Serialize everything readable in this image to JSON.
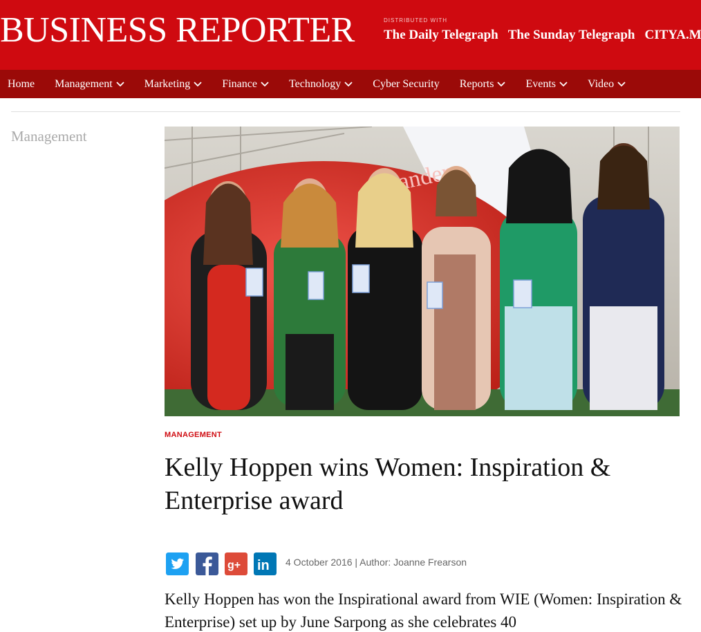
{
  "header": {
    "title": "BUSINESS REPORTER",
    "distributed_label": "DISTRIBUTED WITH",
    "partners": [
      "The Daily Telegraph",
      "The Sunday Telegraph",
      "CITYA.M."
    ]
  },
  "nav": {
    "items": [
      {
        "label": "Home"
      },
      {
        "label": "Management"
      },
      {
        "label": "Marketing"
      },
      {
        "label": "Finance"
      },
      {
        "label": "Technology"
      },
      {
        "label": "Cyber Security"
      },
      {
        "label": "Reports"
      },
      {
        "label": "Events"
      },
      {
        "label": "Video"
      }
    ]
  },
  "sidebar": {
    "section": "Management"
  },
  "article": {
    "category": "MANAGEMENT",
    "headline": "Kelly Hoppen wins Women: Inspiration & Enterprise award",
    "byline": "4 October 2016 | Author: Joanne Frearson",
    "lede": "Kelly Hoppen has won the Inspirational award from WIE (Women: Inspiration & Enterprise) set up by June Sarpong as she celebrates 40",
    "photo_banner_text": "antander"
  },
  "share": {
    "icons": [
      "twitter-icon",
      "facebook-icon",
      "google-plus-icon",
      "linkedin-icon"
    ],
    "colors": {
      "twitter": "#1da1f2",
      "facebook": "#3b5998",
      "google_plus": "#dd4b39",
      "linkedin": "#0077b5"
    }
  },
  "colors": {
    "brand_red": "#cf0a10",
    "nav_red": "#9b0a08"
  }
}
